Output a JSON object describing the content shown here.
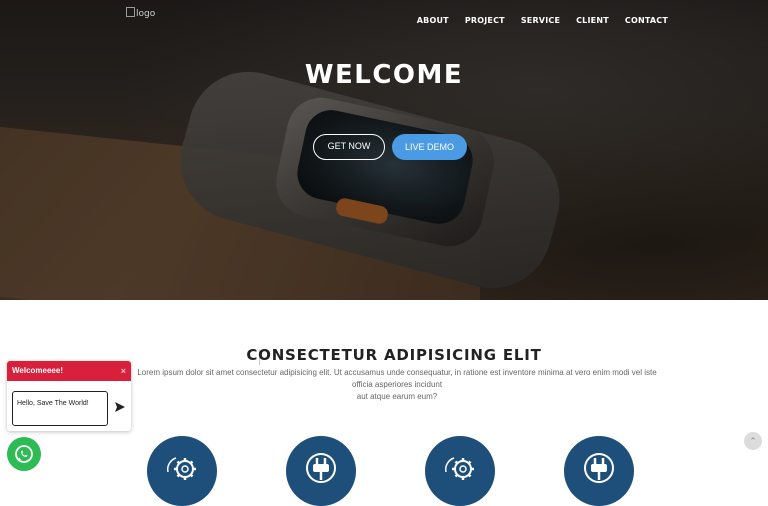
{
  "header": {
    "logo_alt": "logo",
    "nav": [
      "ABOUT",
      "PROJECT",
      "SERVICE",
      "CLIENT",
      "CONTACT"
    ]
  },
  "hero": {
    "title": "WELCOME",
    "get_now": "GET NOW",
    "live_demo": "LIVE DEMO"
  },
  "section": {
    "title": "CONSECTETUR ADIPISICING ELIT",
    "description_line1": "Lorem ipsum dolor sit amet consectetur adipisicing elit. Ut accusamus unde consequatur, in ratione est inventore minima at vero enim modi vel iste officia asperiores incidunt",
    "description_line2": "aut atque earum eum?"
  },
  "features": [
    {
      "icon": "gear-icon"
    },
    {
      "icon": "plug-icon"
    },
    {
      "icon": "gear-icon"
    },
    {
      "icon": "plug-icon"
    }
  ],
  "chat": {
    "header": "Welcomeeee!",
    "close": "×",
    "message": "Hello, Save The World!"
  },
  "colors": {
    "accent_blue": "#4a9be3",
    "chat_red": "#d81f3c",
    "feature_navy": "#1d4f7a",
    "whatsapp_green": "#2dbb54"
  }
}
